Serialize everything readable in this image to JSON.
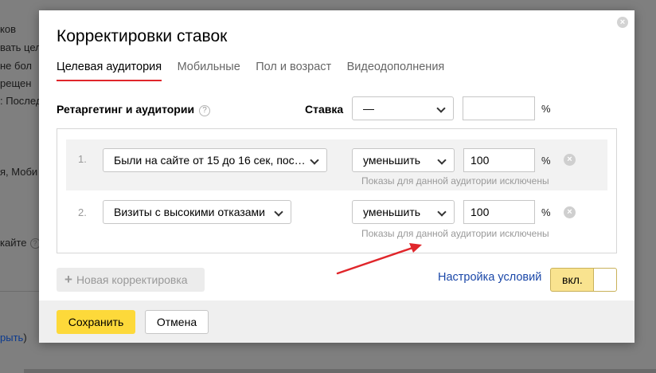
{
  "background": {
    "fragments": [
      "ков",
      "вать цел",
      "не бол",
      "рещен",
      ": Послед",
      "я, Моби",
      "кайте",
      "рыть",
      ")"
    ]
  },
  "modal": {
    "title": "Корректировки ставок",
    "close_icon": "×",
    "tabs": [
      {
        "label": "Целевая аудитория",
        "active": true
      },
      {
        "label": "Мобильные",
        "active": false
      },
      {
        "label": "Пол и возраст",
        "active": false
      },
      {
        "label": "Видеодополнения",
        "active": false
      }
    ],
    "retargeting_label": "Ретаргетинг и аудитории",
    "help_icon": "?",
    "rate": {
      "label": "Ставка",
      "select_value": "—",
      "input_value": "",
      "unit": "%"
    },
    "rows": [
      {
        "number": "1.",
        "audience": "Были на сайте от 15 до 16 сек, пос…",
        "action": "уменьшить",
        "value": "100",
        "unit": "%",
        "hint": "Показы для данной аудитории исключены"
      },
      {
        "number": "2.",
        "audience": "Визиты с высокими отказами",
        "action": "уменьшить",
        "value": "100",
        "unit": "%",
        "hint": "Показы для данной аудитории исключены"
      }
    ],
    "new_button": {
      "plus": "+",
      "label": "Новая корректировка"
    },
    "settings_link": "Настройка условий",
    "toggle": {
      "label": "вкл.",
      "on": true
    },
    "footer": {
      "save": "Сохранить",
      "cancel": "Отмена"
    }
  },
  "colors": {
    "accent_tab": "#e0262b",
    "save_button": "#fdd93a",
    "toggle_on": "#f9e38f",
    "link": "#1a47a8",
    "arrow": "#e0262b"
  }
}
